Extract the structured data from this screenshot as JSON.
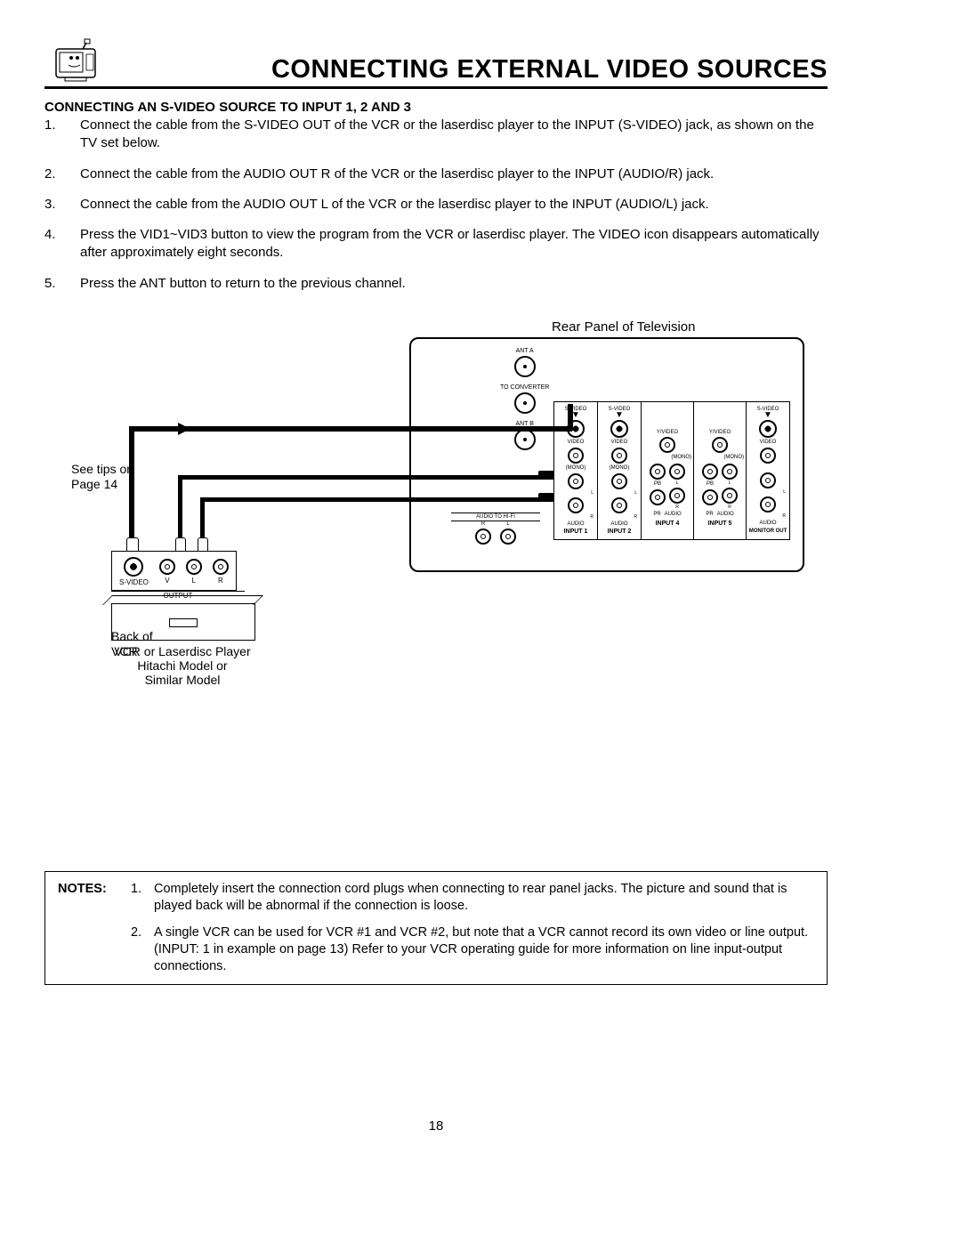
{
  "header": {
    "title": "CONNECTING EXTERNAL VIDEO SOURCES"
  },
  "section_heading": "CONNECTING AN S-VIDEO SOURCE TO INPUT 1, 2 AND 3",
  "steps": [
    {
      "num": "1.",
      "text": "Connect the cable from the S-VIDEO OUT of the VCR or the laserdisc player to the INPUT (S-VIDEO) jack, as shown on the TV set below."
    },
    {
      "num": "2.",
      "text": "Connect the cable from the AUDIO OUT R of the VCR or the laserdisc player to the INPUT (AUDIO/R) jack."
    },
    {
      "num": "3.",
      "text": "Connect the cable from the AUDIO OUT L of the VCR or the laserdisc player to the INPUT (AUDIO/L) jack."
    },
    {
      "num": "4.",
      "text": "Press the VID1~VID3 button to view the program from the VCR or laserdisc player.  The VIDEO icon disappears automatically after approximately eight seconds."
    },
    {
      "num": "5.",
      "text": "Press the ANT button to return to the previous channel."
    }
  ],
  "diagram": {
    "rear_label": "Rear Panel of Television",
    "tips_label_line1": "See tips on",
    "tips_label_line2": "Page 14",
    "ant_a": "ANT A",
    "to_converter": "TO CONVERTER",
    "ant_b": "ANT B",
    "audio_to_hifi": "AUDIO TO HI-FI",
    "r_label": "R",
    "l_label": "L",
    "svideo_label": "S-VIDEO",
    "video_label": "VIDEO",
    "yvideo_label": "Y/VIDEO",
    "mono_label": "(MONO)",
    "pb_label": "PB",
    "pr_label": "PR",
    "audio_label": "AUDIO",
    "input1": "INPUT 1",
    "input2": "INPUT 2",
    "input4": "INPUT 4",
    "input5": "INPUT 5",
    "monitor_out": "MONITOR OUT",
    "vcr_svideo": "S-VIDEO",
    "vcr_v": "V",
    "vcr_l": "L",
    "vcr_r": "R",
    "vcr_output": "OUTPUT",
    "back_of": "Back of",
    "vcr": "VCR",
    "vcr_title": "VCR or Laserdisc Player",
    "hitachi": "Hitachi Model or",
    "similar": "Similar Model"
  },
  "notes": {
    "label": "NOTES:",
    "items": [
      {
        "num": "1.",
        "text": "Completely insert the connection cord plugs when connecting to rear panel jacks.  The picture and sound that is played back will be abnormal if the connection is loose."
      },
      {
        "num": "2.",
        "text": "A single VCR can be used for VCR #1 and VCR #2, but note that a VCR cannot record its own video or line output.  (INPUT: 1 in example on page 13)  Refer to your VCR operating guide for more information on line input-output connections."
      }
    ]
  },
  "page_number": "18"
}
